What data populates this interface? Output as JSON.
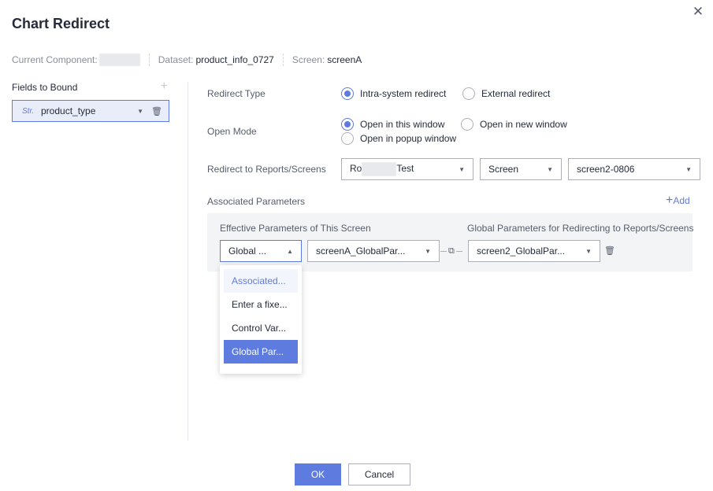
{
  "dialog": {
    "title": "Chart Redirect",
    "close_icon": "close-icon"
  },
  "meta": {
    "current_component_label": "Current Component:",
    "dataset_label": "Dataset:",
    "dataset_value": "product_info_0727",
    "screen_label": "Screen:",
    "screen_value": "screenA"
  },
  "fields": {
    "title": "Fields to Bound",
    "add_icon": "plus-icon",
    "items": [
      {
        "type_tag": "Str.",
        "name": "product_type"
      }
    ]
  },
  "redirect_type": {
    "label": "Redirect Type",
    "options": [
      "Intra-system redirect",
      "External redirect"
    ],
    "selected": "Intra-system redirect"
  },
  "open_mode": {
    "label": "Open Mode",
    "options": [
      "Open in this window",
      "Open in new window",
      "Open in popup window"
    ],
    "selected": "Open in this window"
  },
  "redirect_to": {
    "label": "Redirect to Reports/Screens",
    "target_prefix": "Ro",
    "target_suffix": "Test",
    "kind": "Screen",
    "screen": "screen2-0806"
  },
  "assoc": {
    "label": "Associated Parameters",
    "add_label": "Add",
    "col_effective": "Effective Parameters of This Screen",
    "col_global": "Global Parameters for Redirecting to Reports/Screens",
    "param_type": "Global ...",
    "param_value": "screenA_GlobalPar...",
    "global_value": "screen2_GlobalPar..."
  },
  "dropdown": {
    "options": [
      "Associated...",
      "Enter a fixe...",
      "Control Var...",
      "Global Par..."
    ],
    "hovered": "Associated...",
    "selected": "Global Par..."
  },
  "footer": {
    "ok": "OK",
    "cancel": "Cancel"
  },
  "colors": {
    "accent": "#5e7ce0",
    "text": "#252b3a",
    "muted": "#575d6c",
    "border": "#adb0b8"
  }
}
